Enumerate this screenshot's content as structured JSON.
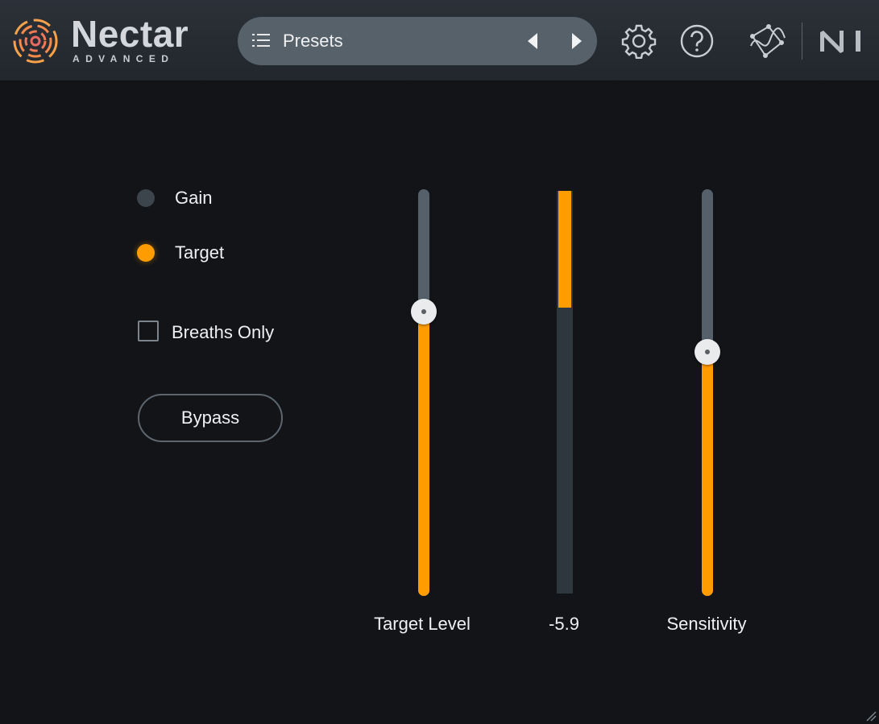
{
  "app": {
    "name": "Nectar",
    "edition": "ADVANCED",
    "brand_color": "#ff9c00"
  },
  "header": {
    "presets_label": "Presets",
    "icons": [
      "presets-list-icon",
      "arrow-left-icon",
      "arrow-right-icon",
      "gear-icon",
      "help-icon",
      "assistant-icon",
      "native-instruments-logo"
    ]
  },
  "mode": {
    "options": [
      {
        "label": "Gain",
        "selected": false
      },
      {
        "label": "Target",
        "selected": true
      }
    ]
  },
  "breaths_only": {
    "label": "Breaths Only",
    "checked": false
  },
  "bypass": {
    "label": "Bypass"
  },
  "target_level": {
    "label": "Target Level",
    "value_fraction": 0.7
  },
  "meter": {
    "value_text": "-5.9",
    "level_fraction": 0.29
  },
  "sensitivity": {
    "label": "Sensitivity",
    "value_fraction": 0.6
  }
}
